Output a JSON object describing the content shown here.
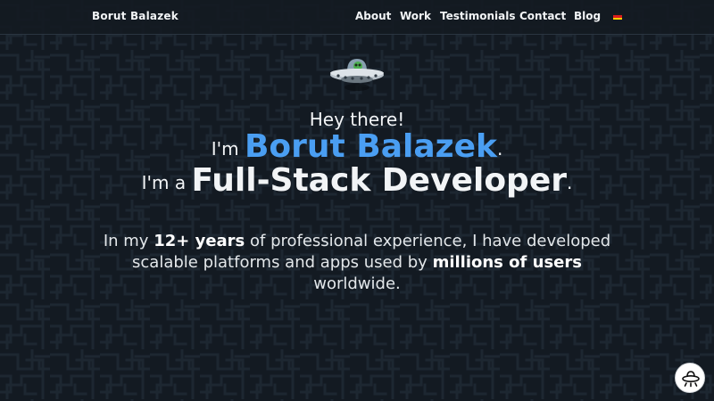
{
  "nav": {
    "brand": "Borut Balazek",
    "items": [
      {
        "label": "About"
      },
      {
        "label": "Work"
      },
      {
        "label": "Testimonials"
      },
      {
        "label": "Contact"
      },
      {
        "label": "Blog"
      }
    ],
    "language_flag": "german-flag-icon"
  },
  "hero": {
    "greeting": "Hey there!",
    "intro_prefix": "I'm",
    "name": "Borut Balazek",
    "intro_suffix": ".",
    "role_prefix": "I'm a",
    "role": "Full-Stack Developer",
    "role_suffix": ".",
    "about_part1": "In my",
    "about_highlight1": "12+ years",
    "about_part2": "of professional experience, I have developed scalable platforms and apps used by",
    "about_highlight2": "millions of users",
    "about_part3": "worldwide."
  },
  "colors": {
    "background": "#131a22",
    "accent": "#4a9ef2",
    "text": "#f2f4f6"
  },
  "floating_button": {
    "icon": "ufo-icon"
  }
}
